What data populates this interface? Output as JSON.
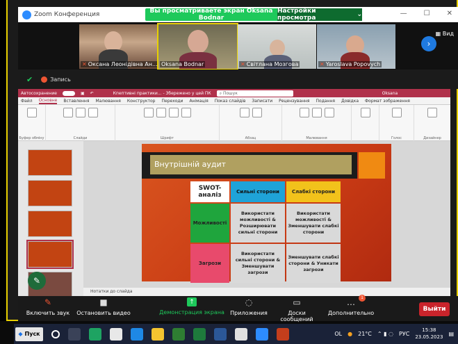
{
  "zoom": {
    "window_title": "Zoom Конференция",
    "share_banner": "Вы просматриваете экран Oksana Bodnar",
    "view_options": "Настройки просмотра",
    "view_label": "Вид",
    "record_label": "Запись",
    "participants": [
      {
        "name": "Оксана Леонідівна Ан..."
      },
      {
        "name": "Oksana Bodnar"
      },
      {
        "name": "Світлана Мозгова"
      },
      {
        "name": "Yaroslava Popovych"
      }
    ],
    "toolbar": {
      "mute": "Включить звук",
      "video": "Остановить видео",
      "share": "Демонстрация экрана",
      "apps": "Приложения",
      "whiteboard": "Доски сообщений",
      "more": "Дополнительно",
      "leave": "Выйти",
      "more_badge": "1"
    }
  },
  "powerpoint": {
    "autosave": "Автосохранение",
    "doc_title": "Кпептивні практики... - Збережено у цей ПК",
    "search_placeholder": "Пошук",
    "user": "Oksana",
    "tabs": [
      "Файл",
      "Основне",
      "Вставлення",
      "Малювання",
      "Конструктор",
      "Переходи",
      "Анімація",
      "Показ слайдів",
      "Записати",
      "Рецензування",
      "Подання",
      "Довідка",
      "Формат зображення"
    ],
    "active_tab": "Основне",
    "groups": [
      "Буфер обміну",
      "Слайди",
      "Шрифт",
      "Абзац",
      "Малювання",
      "Голос",
      "Дизайнер"
    ],
    "notes_label": "Нотатки до слайда",
    "slide": {
      "title": "Внутрішній аудит",
      "swot_header": "SWOT-аналіз",
      "strengths": "Сильні сторони",
      "weaknesses": "Слабкі сторони",
      "opportunities": "Можливості",
      "threats": "Загрози",
      "so": "Використати можливості & Розширювати сильні сторони",
      "wo": "Використати можливості & Зменшувати слабкі сторони",
      "st": "Використати сильні сторони & Зменшувати загрози",
      "wt": "Зменшувати слабкі сторони & Уникати загрози"
    },
    "thumbnails": [
      "",
      "",
      "",
      "",
      ""
    ]
  },
  "taskbar": {
    "start": "Пуск",
    "weather": "21°C",
    "lang": "РУС",
    "time": "15:38",
    "date": "23.05.2023",
    "ol": "OL"
  },
  "colors": {
    "zoom_green": "#1ec95b",
    "ppt_accent": "#b0314b",
    "slide_bg": "#c83a14",
    "strengths_blue": "#1fa3d8",
    "weaknesses_yellow": "#f2c21b",
    "opportunities_green": "#1fa53d",
    "threats_pink": "#e84a6c"
  }
}
